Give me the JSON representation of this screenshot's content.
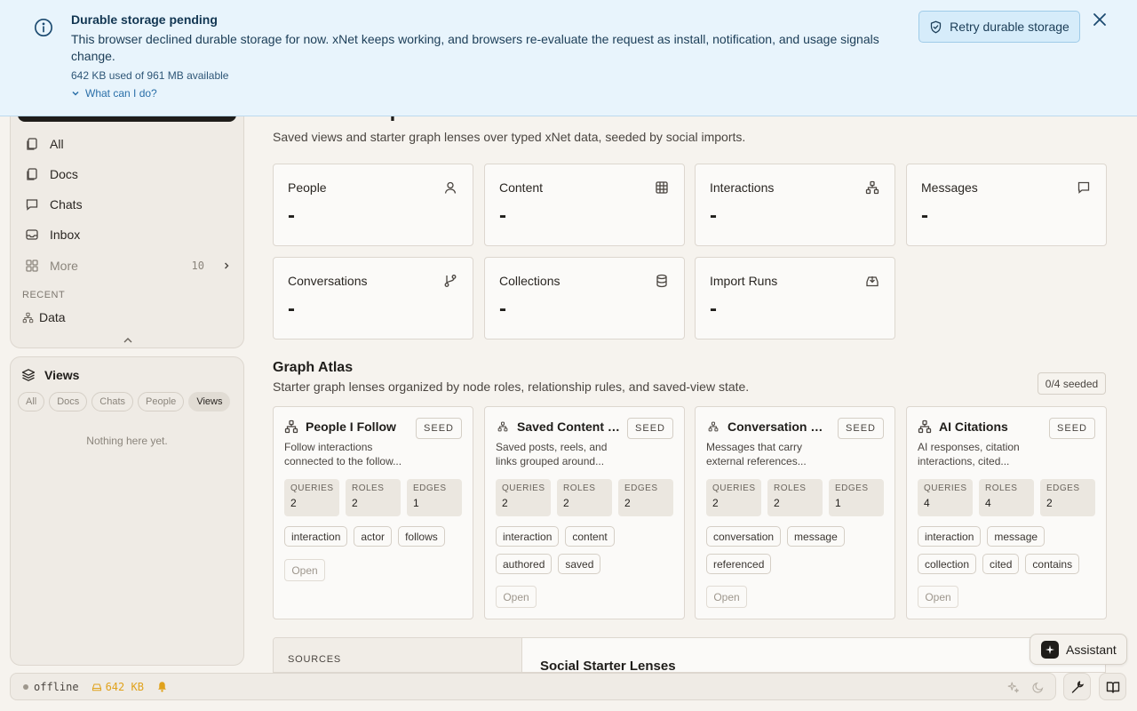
{
  "banner": {
    "title": "Durable storage pending",
    "text": "This browser declined durable storage for now. xNet keeps working, and browsers re-evaluate the request as install, notification, and usage signals change.",
    "usage": "642 KB used of 961 MB available",
    "more_link": "What can I do?",
    "retry_label": "Retry durable storage"
  },
  "sidebar": {
    "nav": [
      {
        "label": "All",
        "icon": "files-icon"
      },
      {
        "label": "Docs",
        "icon": "files-icon"
      },
      {
        "label": "Chats",
        "icon": "chat-icon"
      },
      {
        "label": "Inbox",
        "icon": "inbox-icon"
      },
      {
        "label": "More",
        "icon": "grid-icon",
        "count": "10"
      }
    ],
    "recent_label": "RECENT",
    "recent_items": [
      {
        "label": "Data",
        "icon": "network-icon"
      }
    ]
  },
  "views": {
    "title": "Views",
    "filters": [
      "All",
      "Docs",
      "Chats",
      "People",
      "Views"
    ],
    "active_filter": "Views",
    "empty": "Nothing here yet."
  },
  "page": {
    "title": "Data Workspace",
    "subtitle": "Saved views and starter graph lenses over typed xNet data, seeded by social imports."
  },
  "stats": [
    {
      "label": "People",
      "value": "-",
      "icon": "person-icon"
    },
    {
      "label": "Content",
      "value": "-",
      "icon": "table-icon"
    },
    {
      "label": "Interactions",
      "value": "-",
      "icon": "network-icon"
    },
    {
      "label": "Messages",
      "value": "-",
      "icon": "message-icon"
    },
    {
      "label": "Conversations",
      "value": "-",
      "icon": "git-branch-icon"
    },
    {
      "label": "Collections",
      "value": "-",
      "icon": "database-icon"
    },
    {
      "label": "Import Runs",
      "value": "-",
      "icon": "import-icon"
    }
  ],
  "atlas": {
    "title": "Graph Atlas",
    "subtitle": "Starter graph lenses organized by node roles, relationship rules, and saved-view state.",
    "seeded": "0/4 seeded",
    "metric_labels": [
      "QUERIES",
      "ROLES",
      "EDGES"
    ],
    "seed_label": "SEED",
    "open_label": "Open",
    "lenses": [
      {
        "title": "People I Follow",
        "desc1": "Follow interactions",
        "desc2": "connected to the follow...",
        "queries": "2",
        "roles": "2",
        "edges": "1",
        "tags": [
          "interaction",
          "actor",
          "follows"
        ]
      },
      {
        "title": "Saved Content B...",
        "desc1": "Saved posts, reels, and",
        "desc2": "links grouped around...",
        "queries": "2",
        "roles": "2",
        "edges": "2",
        "tags": [
          "interaction",
          "content",
          "authored",
          "saved"
        ]
      },
      {
        "title": "Conversation Ref...",
        "desc1": "Messages that carry",
        "desc2": "external references...",
        "queries": "2",
        "roles": "2",
        "edges": "1",
        "tags": [
          "conversation",
          "message",
          "referenced"
        ]
      },
      {
        "title": "AI Citations",
        "desc1": "AI responses, citation",
        "desc2": "interactions, cited...",
        "queries": "4",
        "roles": "4",
        "edges": "2",
        "tags": [
          "interaction",
          "message",
          "collection",
          "cited",
          "contains"
        ]
      }
    ]
  },
  "bottom": {
    "sources_label": "SOURCES",
    "section_title": "Social Starter Lenses"
  },
  "assistant": {
    "label": "Assistant"
  },
  "statusbar": {
    "status": "offline",
    "storage": "642 KB"
  },
  "colors": {
    "banner_bg": "#e8f4fc",
    "accent_blue": "#2a6fa8",
    "storage_warning": "#e0a21c",
    "page_bg": "#f6f3ee"
  }
}
